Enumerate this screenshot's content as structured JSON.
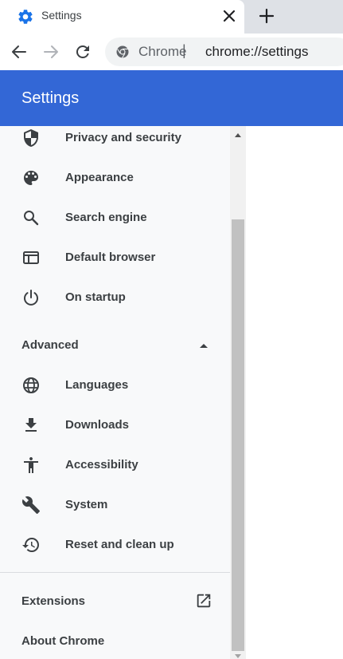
{
  "tab": {
    "title": "Settings",
    "icon": "gear-icon"
  },
  "toolbar": {
    "back": "arrow-back-icon",
    "forward": "arrow-forward-icon",
    "reload": "reload-icon",
    "omnibox": {
      "origin": "Chrome",
      "separator": "|",
      "url": "chrome://settings"
    }
  },
  "header": {
    "title": "Settings",
    "color": "#3367d6"
  },
  "sidebar": {
    "items": [
      {
        "label": "Privacy and security",
        "icon": "shield-icon"
      },
      {
        "label": "Appearance",
        "icon": "palette-icon"
      },
      {
        "label": "Search engine",
        "icon": "search-icon"
      },
      {
        "label": "Default browser",
        "icon": "browser-window-icon"
      },
      {
        "label": "On startup",
        "icon": "power-icon"
      }
    ],
    "advanced": {
      "label": "Advanced",
      "expanded": true,
      "items": [
        {
          "label": "Languages",
          "icon": "globe-icon"
        },
        {
          "label": "Downloads",
          "icon": "download-icon"
        },
        {
          "label": "Accessibility",
          "icon": "accessibility-icon"
        },
        {
          "label": "System",
          "icon": "wrench-icon"
        },
        {
          "label": "Reset and clean up",
          "icon": "history-icon"
        }
      ]
    },
    "extensions": {
      "label": "Extensions",
      "icon": "open-in-new-icon"
    },
    "about": {
      "label": "About Chrome"
    }
  }
}
